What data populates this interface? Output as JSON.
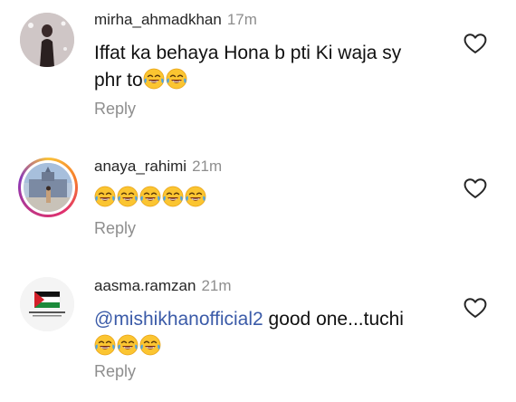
{
  "comments": [
    {
      "username": "mirha_ahmadkhan",
      "time": "17m",
      "text_line1": "Iffat ka behaya Hona b pti Ki waja sy",
      "text_line2": "phr to",
      "emoji_icons": [
        "face-with-tears-of-joy-icon",
        "face-with-tears-of-joy-icon"
      ],
      "reply_label": "Reply"
    },
    {
      "username": "anaya_rahimi",
      "time": "21m",
      "emoji_icons": [
        "face-with-tears-of-joy-icon",
        "face-with-tears-of-joy-icon",
        "face-with-tears-of-joy-icon",
        "face-with-tears-of-joy-icon",
        "face-with-tears-of-joy-icon"
      ],
      "reply_label": "Reply",
      "has_story_ring": true
    },
    {
      "username": "aasma.ramzan",
      "time": "21m",
      "mention": "@mishikhanofficial2",
      "text_after_mention": " good one...tuchi",
      "emoji_icons": [
        "face-with-tears-of-joy-icon",
        "face-with-tears-of-joy-icon",
        "face-with-tears-of-joy-icon"
      ],
      "reply_label": "Reply"
    }
  ],
  "colors": {
    "username": "#262626",
    "timestamp": "#8e8e8e",
    "reply": "#8e8e8e",
    "mention": "#3b5ba8",
    "heart_outline": "#262626"
  },
  "icons": {
    "like": "heart-outline-icon"
  }
}
